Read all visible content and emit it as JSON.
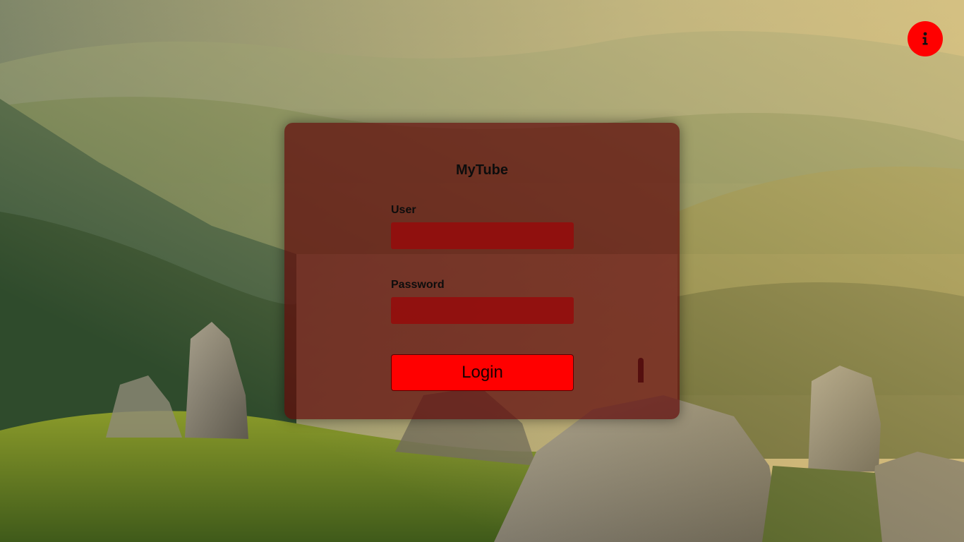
{
  "app": {
    "title": "MyTube"
  },
  "login_form": {
    "user_label": "User",
    "user_value": "",
    "password_label": "Password",
    "password_value": "",
    "submit_label": "Login"
  },
  "info_button": {
    "icon": "info-icon"
  },
  "colors": {
    "accent": "#ff0000",
    "card_background": "#5f0a0a",
    "input_background": "#960a0a"
  }
}
